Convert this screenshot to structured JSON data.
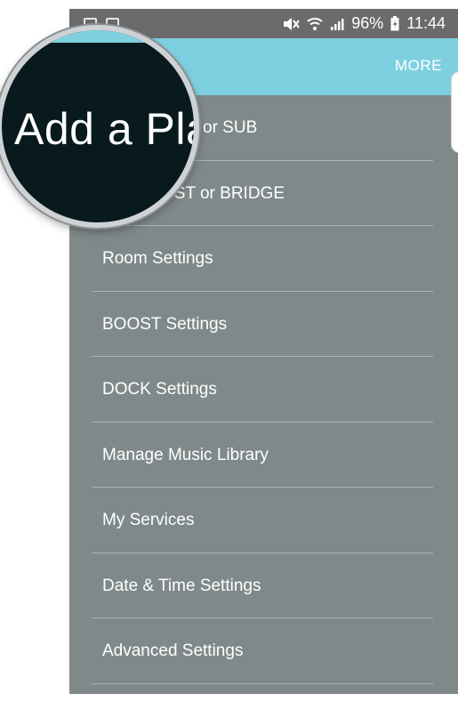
{
  "status_bar": {
    "battery": "96%",
    "time": "11:44",
    "left_icons": [
      "notification-icon",
      "image-icon"
    ],
    "right_icons": [
      "mute-icon",
      "wifi-icon",
      "signal-icon",
      "battery-icon"
    ]
  },
  "header": {
    "more_label": "MORE"
  },
  "menu": {
    "items": [
      {
        "label": "or SUB"
      },
      {
        "label": "OST or BRIDGE"
      },
      {
        "label": "Room Settings"
      },
      {
        "label": "BOOST Settings"
      },
      {
        "label": "DOCK Settings"
      },
      {
        "label": "Manage Music Library"
      },
      {
        "label": "My Services"
      },
      {
        "label": "Date & Time Settings"
      },
      {
        "label": "Advanced Settings"
      }
    ]
  },
  "magnifier": {
    "text": "Add a Pla"
  },
  "colors": {
    "header": "#7ed0e0",
    "menu_background": "#7f8989",
    "status_bar": "#6b6b6b",
    "magnifier_background": "#081a1e"
  }
}
